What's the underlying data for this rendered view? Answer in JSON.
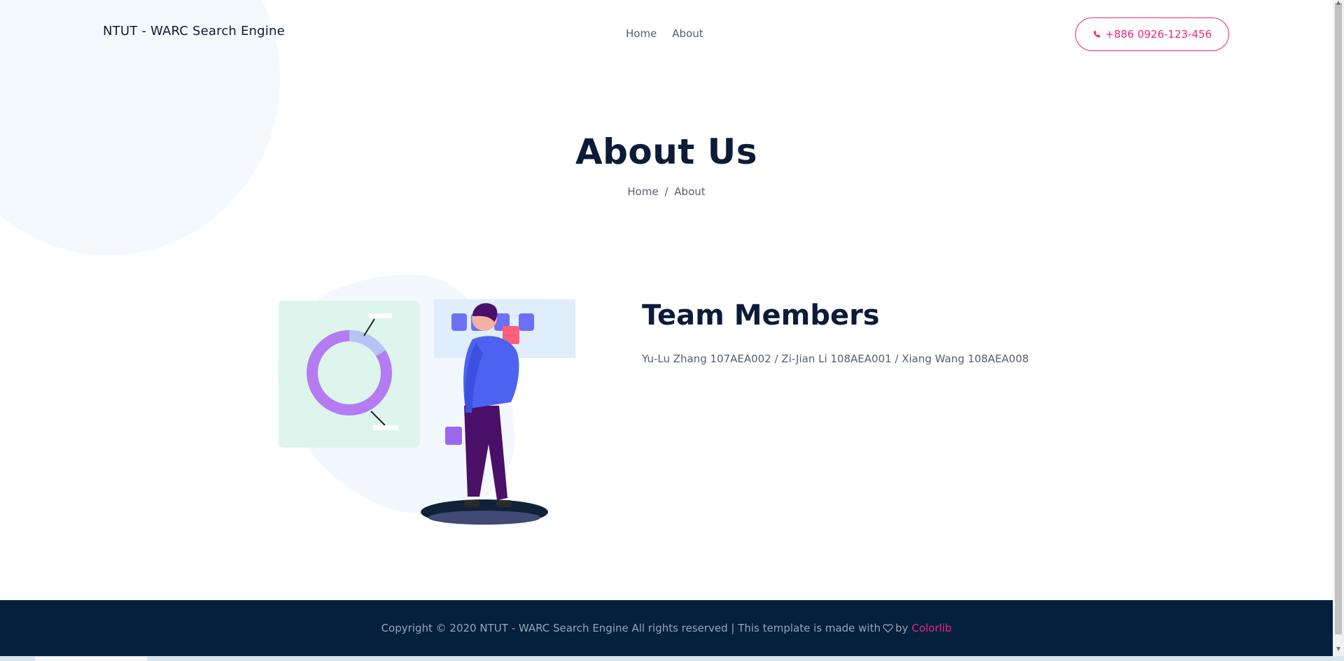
{
  "header": {
    "brand": "NTUT - WARC Search Engine",
    "nav": [
      {
        "label": "Home"
      },
      {
        "label": "About"
      }
    ],
    "phone_label": "+886 0926-123-456"
  },
  "banner": {
    "title": "About Us",
    "breadcrumb": [
      {
        "label": "Home"
      },
      {
        "label": "About"
      }
    ],
    "separator": "/"
  },
  "team": {
    "title": "Team Members",
    "members_text": "Yu-Lu Zhang 107AEA002 / Zi-Jian Li 108AEA001 / Xiang Wang 108AEA008"
  },
  "footer": {
    "copyright_prefix": "Copyright © 2020 NTUT - WARC Search Engine All rights reserved | This template is made with",
    "by_label": "by",
    "credit_link": "Colorlib"
  },
  "colors": {
    "accent": "#f12479",
    "navy": "#0b1c39",
    "footer_bg": "#04203d",
    "body_text": "#555e6e"
  },
  "icons": {
    "phone": "phone-icon",
    "heart": "heart-outline-icon"
  }
}
